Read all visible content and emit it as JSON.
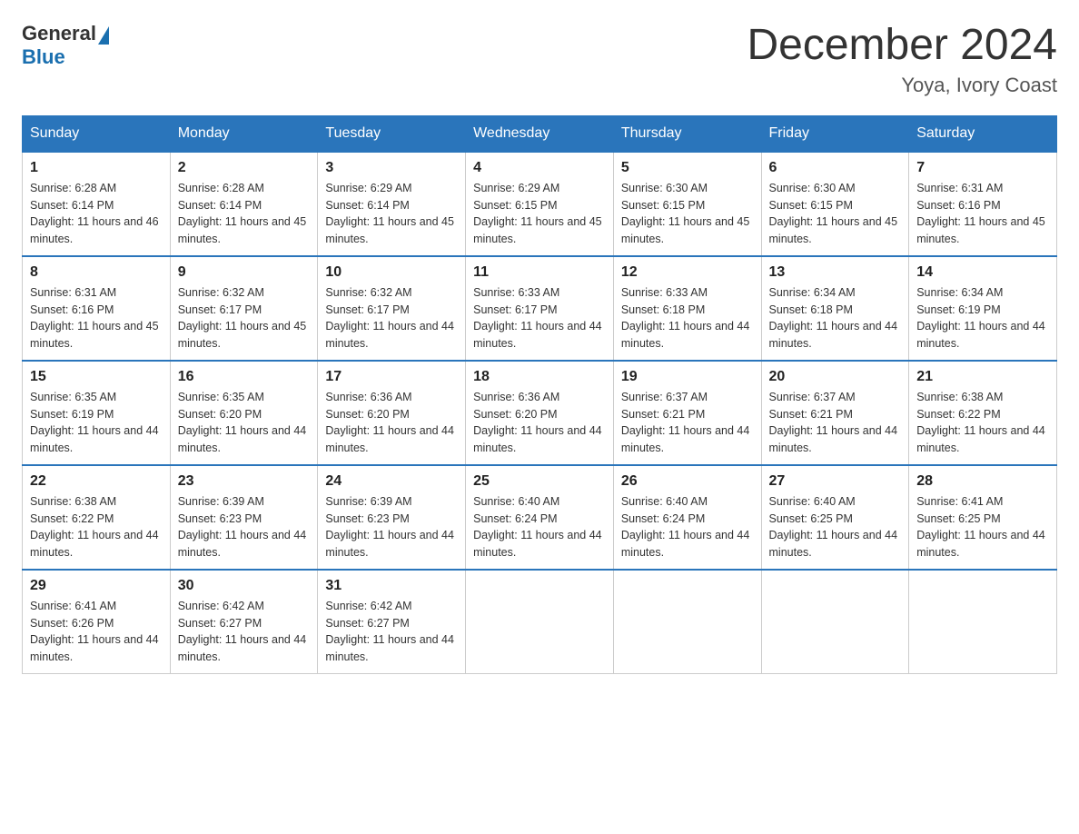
{
  "logo": {
    "general": "General",
    "blue": "Blue"
  },
  "title": "December 2024",
  "location": "Yoya, Ivory Coast",
  "weekdays": [
    "Sunday",
    "Monday",
    "Tuesday",
    "Wednesday",
    "Thursday",
    "Friday",
    "Saturday"
  ],
  "weeks": [
    [
      {
        "day": "1",
        "sunrise": "6:28 AM",
        "sunset": "6:14 PM",
        "daylight": "11 hours and 46 minutes."
      },
      {
        "day": "2",
        "sunrise": "6:28 AM",
        "sunset": "6:14 PM",
        "daylight": "11 hours and 45 minutes."
      },
      {
        "day": "3",
        "sunrise": "6:29 AM",
        "sunset": "6:14 PM",
        "daylight": "11 hours and 45 minutes."
      },
      {
        "day": "4",
        "sunrise": "6:29 AM",
        "sunset": "6:15 PM",
        "daylight": "11 hours and 45 minutes."
      },
      {
        "day": "5",
        "sunrise": "6:30 AM",
        "sunset": "6:15 PM",
        "daylight": "11 hours and 45 minutes."
      },
      {
        "day": "6",
        "sunrise": "6:30 AM",
        "sunset": "6:15 PM",
        "daylight": "11 hours and 45 minutes."
      },
      {
        "day": "7",
        "sunrise": "6:31 AM",
        "sunset": "6:16 PM",
        "daylight": "11 hours and 45 minutes."
      }
    ],
    [
      {
        "day": "8",
        "sunrise": "6:31 AM",
        "sunset": "6:16 PM",
        "daylight": "11 hours and 45 minutes."
      },
      {
        "day": "9",
        "sunrise": "6:32 AM",
        "sunset": "6:17 PM",
        "daylight": "11 hours and 45 minutes."
      },
      {
        "day": "10",
        "sunrise": "6:32 AM",
        "sunset": "6:17 PM",
        "daylight": "11 hours and 44 minutes."
      },
      {
        "day": "11",
        "sunrise": "6:33 AM",
        "sunset": "6:17 PM",
        "daylight": "11 hours and 44 minutes."
      },
      {
        "day": "12",
        "sunrise": "6:33 AM",
        "sunset": "6:18 PM",
        "daylight": "11 hours and 44 minutes."
      },
      {
        "day": "13",
        "sunrise": "6:34 AM",
        "sunset": "6:18 PM",
        "daylight": "11 hours and 44 minutes."
      },
      {
        "day": "14",
        "sunrise": "6:34 AM",
        "sunset": "6:19 PM",
        "daylight": "11 hours and 44 minutes."
      }
    ],
    [
      {
        "day": "15",
        "sunrise": "6:35 AM",
        "sunset": "6:19 PM",
        "daylight": "11 hours and 44 minutes."
      },
      {
        "day": "16",
        "sunrise": "6:35 AM",
        "sunset": "6:20 PM",
        "daylight": "11 hours and 44 minutes."
      },
      {
        "day": "17",
        "sunrise": "6:36 AM",
        "sunset": "6:20 PM",
        "daylight": "11 hours and 44 minutes."
      },
      {
        "day": "18",
        "sunrise": "6:36 AM",
        "sunset": "6:20 PM",
        "daylight": "11 hours and 44 minutes."
      },
      {
        "day": "19",
        "sunrise": "6:37 AM",
        "sunset": "6:21 PM",
        "daylight": "11 hours and 44 minutes."
      },
      {
        "day": "20",
        "sunrise": "6:37 AM",
        "sunset": "6:21 PM",
        "daylight": "11 hours and 44 minutes."
      },
      {
        "day": "21",
        "sunrise": "6:38 AM",
        "sunset": "6:22 PM",
        "daylight": "11 hours and 44 minutes."
      }
    ],
    [
      {
        "day": "22",
        "sunrise": "6:38 AM",
        "sunset": "6:22 PM",
        "daylight": "11 hours and 44 minutes."
      },
      {
        "day": "23",
        "sunrise": "6:39 AM",
        "sunset": "6:23 PM",
        "daylight": "11 hours and 44 minutes."
      },
      {
        "day": "24",
        "sunrise": "6:39 AM",
        "sunset": "6:23 PM",
        "daylight": "11 hours and 44 minutes."
      },
      {
        "day": "25",
        "sunrise": "6:40 AM",
        "sunset": "6:24 PM",
        "daylight": "11 hours and 44 minutes."
      },
      {
        "day": "26",
        "sunrise": "6:40 AM",
        "sunset": "6:24 PM",
        "daylight": "11 hours and 44 minutes."
      },
      {
        "day": "27",
        "sunrise": "6:40 AM",
        "sunset": "6:25 PM",
        "daylight": "11 hours and 44 minutes."
      },
      {
        "day": "28",
        "sunrise": "6:41 AM",
        "sunset": "6:25 PM",
        "daylight": "11 hours and 44 minutes."
      }
    ],
    [
      {
        "day": "29",
        "sunrise": "6:41 AM",
        "sunset": "6:26 PM",
        "daylight": "11 hours and 44 minutes."
      },
      {
        "day": "30",
        "sunrise": "6:42 AM",
        "sunset": "6:27 PM",
        "daylight": "11 hours and 44 minutes."
      },
      {
        "day": "31",
        "sunrise": "6:42 AM",
        "sunset": "6:27 PM",
        "daylight": "11 hours and 44 minutes."
      },
      null,
      null,
      null,
      null
    ]
  ]
}
